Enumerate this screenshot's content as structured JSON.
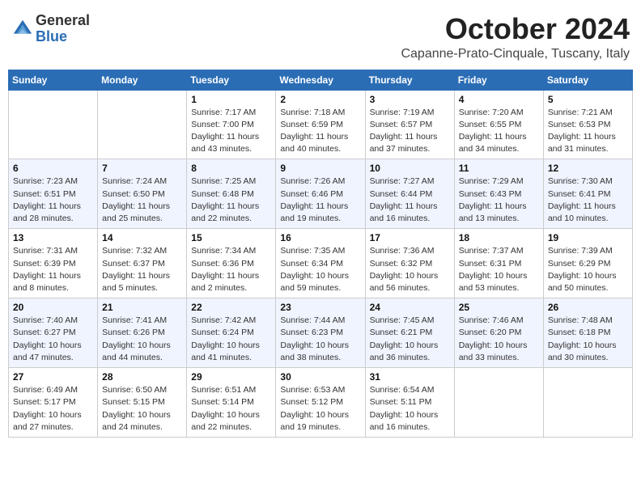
{
  "header": {
    "logo_general": "General",
    "logo_blue": "Blue",
    "month_title": "October 2024",
    "location": "Capanne-Prato-Cinquale, Tuscany, Italy"
  },
  "weekdays": [
    "Sunday",
    "Monday",
    "Tuesday",
    "Wednesday",
    "Thursday",
    "Friday",
    "Saturday"
  ],
  "weeks": [
    [
      {
        "day": "",
        "info": ""
      },
      {
        "day": "",
        "info": ""
      },
      {
        "day": "1",
        "info": "Sunrise: 7:17 AM\nSunset: 7:00 PM\nDaylight: 11 hours and 43 minutes."
      },
      {
        "day": "2",
        "info": "Sunrise: 7:18 AM\nSunset: 6:59 PM\nDaylight: 11 hours and 40 minutes."
      },
      {
        "day": "3",
        "info": "Sunrise: 7:19 AM\nSunset: 6:57 PM\nDaylight: 11 hours and 37 minutes."
      },
      {
        "day": "4",
        "info": "Sunrise: 7:20 AM\nSunset: 6:55 PM\nDaylight: 11 hours and 34 minutes."
      },
      {
        "day": "5",
        "info": "Sunrise: 7:21 AM\nSunset: 6:53 PM\nDaylight: 11 hours and 31 minutes."
      }
    ],
    [
      {
        "day": "6",
        "info": "Sunrise: 7:23 AM\nSunset: 6:51 PM\nDaylight: 11 hours and 28 minutes."
      },
      {
        "day": "7",
        "info": "Sunrise: 7:24 AM\nSunset: 6:50 PM\nDaylight: 11 hours and 25 minutes."
      },
      {
        "day": "8",
        "info": "Sunrise: 7:25 AM\nSunset: 6:48 PM\nDaylight: 11 hours and 22 minutes."
      },
      {
        "day": "9",
        "info": "Sunrise: 7:26 AM\nSunset: 6:46 PM\nDaylight: 11 hours and 19 minutes."
      },
      {
        "day": "10",
        "info": "Sunrise: 7:27 AM\nSunset: 6:44 PM\nDaylight: 11 hours and 16 minutes."
      },
      {
        "day": "11",
        "info": "Sunrise: 7:29 AM\nSunset: 6:43 PM\nDaylight: 11 hours and 13 minutes."
      },
      {
        "day": "12",
        "info": "Sunrise: 7:30 AM\nSunset: 6:41 PM\nDaylight: 11 hours and 10 minutes."
      }
    ],
    [
      {
        "day": "13",
        "info": "Sunrise: 7:31 AM\nSunset: 6:39 PM\nDaylight: 11 hours and 8 minutes."
      },
      {
        "day": "14",
        "info": "Sunrise: 7:32 AM\nSunset: 6:37 PM\nDaylight: 11 hours and 5 minutes."
      },
      {
        "day": "15",
        "info": "Sunrise: 7:34 AM\nSunset: 6:36 PM\nDaylight: 11 hours and 2 minutes."
      },
      {
        "day": "16",
        "info": "Sunrise: 7:35 AM\nSunset: 6:34 PM\nDaylight: 10 hours and 59 minutes."
      },
      {
        "day": "17",
        "info": "Sunrise: 7:36 AM\nSunset: 6:32 PM\nDaylight: 10 hours and 56 minutes."
      },
      {
        "day": "18",
        "info": "Sunrise: 7:37 AM\nSunset: 6:31 PM\nDaylight: 10 hours and 53 minutes."
      },
      {
        "day": "19",
        "info": "Sunrise: 7:39 AM\nSunset: 6:29 PM\nDaylight: 10 hours and 50 minutes."
      }
    ],
    [
      {
        "day": "20",
        "info": "Sunrise: 7:40 AM\nSunset: 6:27 PM\nDaylight: 10 hours and 47 minutes."
      },
      {
        "day": "21",
        "info": "Sunrise: 7:41 AM\nSunset: 6:26 PM\nDaylight: 10 hours and 44 minutes."
      },
      {
        "day": "22",
        "info": "Sunrise: 7:42 AM\nSunset: 6:24 PM\nDaylight: 10 hours and 41 minutes."
      },
      {
        "day": "23",
        "info": "Sunrise: 7:44 AM\nSunset: 6:23 PM\nDaylight: 10 hours and 38 minutes."
      },
      {
        "day": "24",
        "info": "Sunrise: 7:45 AM\nSunset: 6:21 PM\nDaylight: 10 hours and 36 minutes."
      },
      {
        "day": "25",
        "info": "Sunrise: 7:46 AM\nSunset: 6:20 PM\nDaylight: 10 hours and 33 minutes."
      },
      {
        "day": "26",
        "info": "Sunrise: 7:48 AM\nSunset: 6:18 PM\nDaylight: 10 hours and 30 minutes."
      }
    ],
    [
      {
        "day": "27",
        "info": "Sunrise: 6:49 AM\nSunset: 5:17 PM\nDaylight: 10 hours and 27 minutes."
      },
      {
        "day": "28",
        "info": "Sunrise: 6:50 AM\nSunset: 5:15 PM\nDaylight: 10 hours and 24 minutes."
      },
      {
        "day": "29",
        "info": "Sunrise: 6:51 AM\nSunset: 5:14 PM\nDaylight: 10 hours and 22 minutes."
      },
      {
        "day": "30",
        "info": "Sunrise: 6:53 AM\nSunset: 5:12 PM\nDaylight: 10 hours and 19 minutes."
      },
      {
        "day": "31",
        "info": "Sunrise: 6:54 AM\nSunset: 5:11 PM\nDaylight: 10 hours and 16 minutes."
      },
      {
        "day": "",
        "info": ""
      },
      {
        "day": "",
        "info": ""
      }
    ]
  ]
}
